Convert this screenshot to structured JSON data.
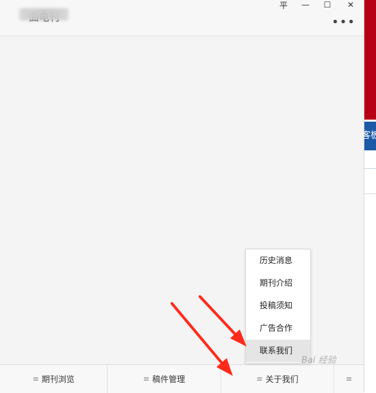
{
  "window": {
    "title": "曲电刊",
    "controls": {
      "pin": "平",
      "minimize": "—",
      "maximize": "☐",
      "close": "✕"
    },
    "more": "•••"
  },
  "bottom_bar": {
    "items": [
      {
        "label": "期刊浏览"
      },
      {
        "label": "稿件管理"
      },
      {
        "label": "关于我们"
      }
    ],
    "menu_icon": "≡"
  },
  "popup_menu": {
    "items": [
      "历史消息",
      "期刊介绍",
      "投稿须知",
      "广告合作",
      "联系我们"
    ],
    "active_index": 4
  },
  "right_strip": {
    "blue_text": "客板"
  },
  "watermark": "Bai 经验",
  "colors": {
    "accent_red": "#b70016",
    "accent_blue": "#1c5aa8",
    "arrow_red": "#ff2a1a"
  }
}
